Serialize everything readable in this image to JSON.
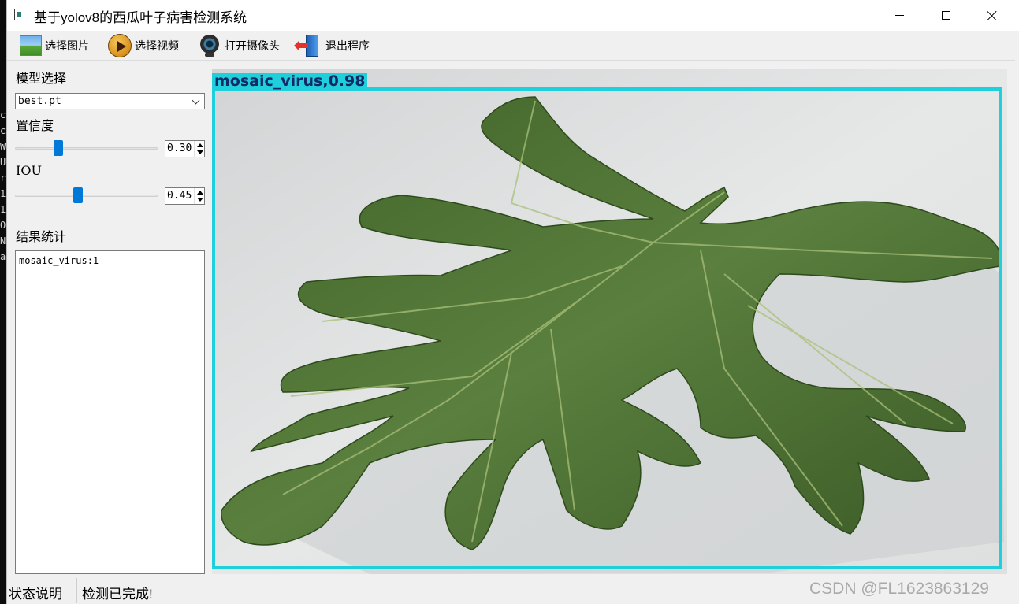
{
  "window": {
    "title": "基于yolov8的西瓜叶子病害检测系统"
  },
  "desktop_strip_chars": [
    "c",
    "c",
    "W",
    "U",
    "r",
    "1",
    "1",
    "O",
    "N",
    "a"
  ],
  "toolbar": {
    "select_image": "选择图片",
    "select_video": "选择视频",
    "open_camera": "打开摄像头",
    "exit": "退出程序"
  },
  "left_panel": {
    "model_label": "模型选择",
    "model_value": "best.pt",
    "confidence_label": "置信度",
    "confidence_value": "0.30",
    "confidence": 0.3,
    "iou_label": "IOU",
    "iou_value": "0.45",
    "iou": 0.45,
    "results_label": "结果统计",
    "results_text": "mosaic_virus:1"
  },
  "detection": {
    "label": "mosaic_virus,0.98",
    "box_color": "#1fcfdc"
  },
  "status_bar": {
    "label": "状态说明",
    "message": "检测已完成!",
    "watermark": "CSDN @FL1623863129"
  },
  "colors": {
    "accent": "#0078d7",
    "leaf": "#4f7336",
    "background": "#dbdcdc"
  }
}
